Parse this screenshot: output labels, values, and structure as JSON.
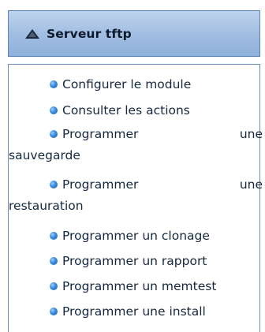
{
  "panel": {
    "title": "Serveur tftp",
    "icon": "collapse-triangle-icon"
  },
  "menu": {
    "items": [
      {
        "label": "Configurer le module"
      },
      {
        "label": "Consulter les actions"
      },
      {
        "label_first": "Programmer",
        "label_right": "une",
        "label_second": "sauvegarde"
      },
      {
        "label_first": "Programmer",
        "label_right": "une",
        "label_second": "restauration"
      },
      {
        "label": "Programmer un clonage"
      },
      {
        "label": "Programmer un rapport"
      },
      {
        "label": "Programmer un memtest"
      },
      {
        "label": "Programmer une install"
      }
    ]
  },
  "colors": {
    "header_bg": "#a4c0e3",
    "header_border": "#5a83b5",
    "bullet": "#3d8fe0",
    "text": "#15283f"
  }
}
